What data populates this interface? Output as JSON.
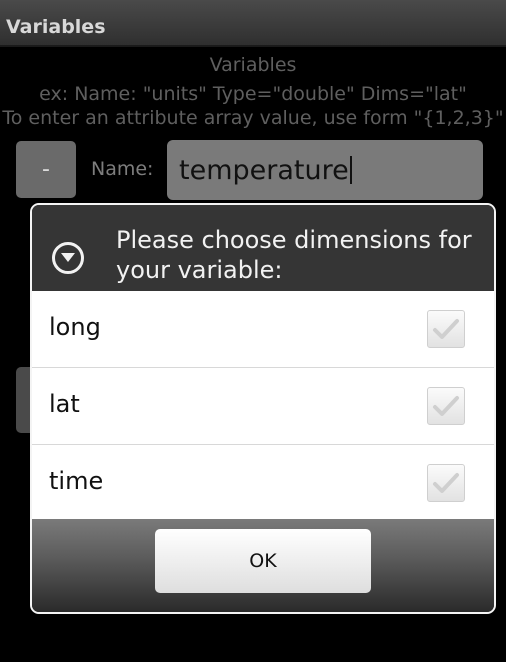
{
  "app": {
    "title": "Variables"
  },
  "header": {
    "heading": "Variables",
    "example": "ex: Name: \"units\" Type=\"double\" Dims=\"lat\"",
    "hint": "To enter an attribute array value, use form \"{1,2,3}\""
  },
  "form": {
    "minus_label": "-",
    "name_label": "Name:",
    "name_value": "temperature"
  },
  "dialog": {
    "title": "Please choose dimensions for your variable:",
    "options": [
      {
        "label": "long",
        "checked": false
      },
      {
        "label": "lat",
        "checked": false
      },
      {
        "label": "time",
        "checked": false
      }
    ],
    "ok_label": "OK"
  }
}
